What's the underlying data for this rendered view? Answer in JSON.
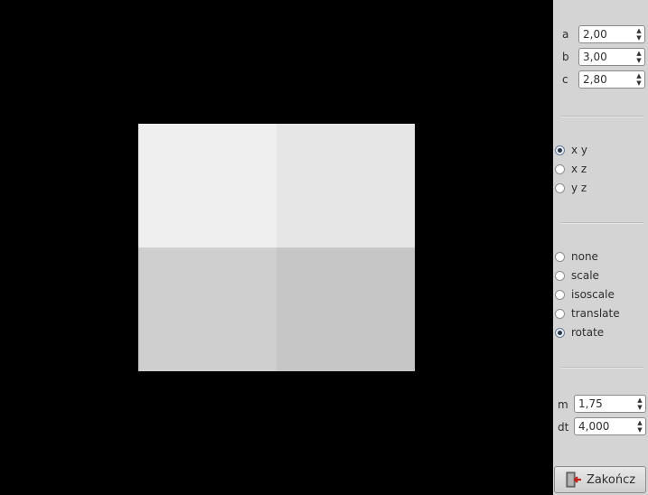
{
  "viewport": {
    "quad_colors": [
      "#efefef",
      "#e6e6e6",
      "#cfcfcf",
      "#c6c6c6"
    ]
  },
  "params": {
    "a_label": "a",
    "a_value": "2,00",
    "b_label": "b",
    "b_value": "3,00",
    "c_label": "c",
    "c_value": "2,80"
  },
  "plane": {
    "options": [
      "x y",
      "x z",
      "y z"
    ],
    "selected": "x y"
  },
  "transform": {
    "options": [
      "none",
      "scale",
      "isoscale",
      "translate",
      "rotate"
    ],
    "selected": "rotate"
  },
  "anim": {
    "m_label": "m",
    "m_value": "1,75",
    "dt_label": "dt",
    "dt_value": "4,000"
  },
  "quit_button": {
    "label": "Zakończ",
    "icon": "exit-icon"
  }
}
